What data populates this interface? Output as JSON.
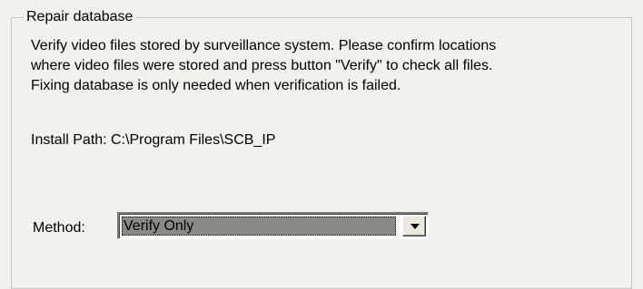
{
  "repair_group": {
    "title": "Repair database",
    "description_lines": [
      "Verify video files stored by surveillance system. Please confirm locations",
      "where video files were stored and press button \"Verify\" to check all files.",
      "Fixing database is only needed when verification is failed."
    ],
    "install_path": "Install Path: C:\\Program Files\\SCB_IP",
    "method": {
      "label": "Method:",
      "selected": "Verify Only",
      "dropdown_icon": "chevron-down-icon"
    }
  }
}
